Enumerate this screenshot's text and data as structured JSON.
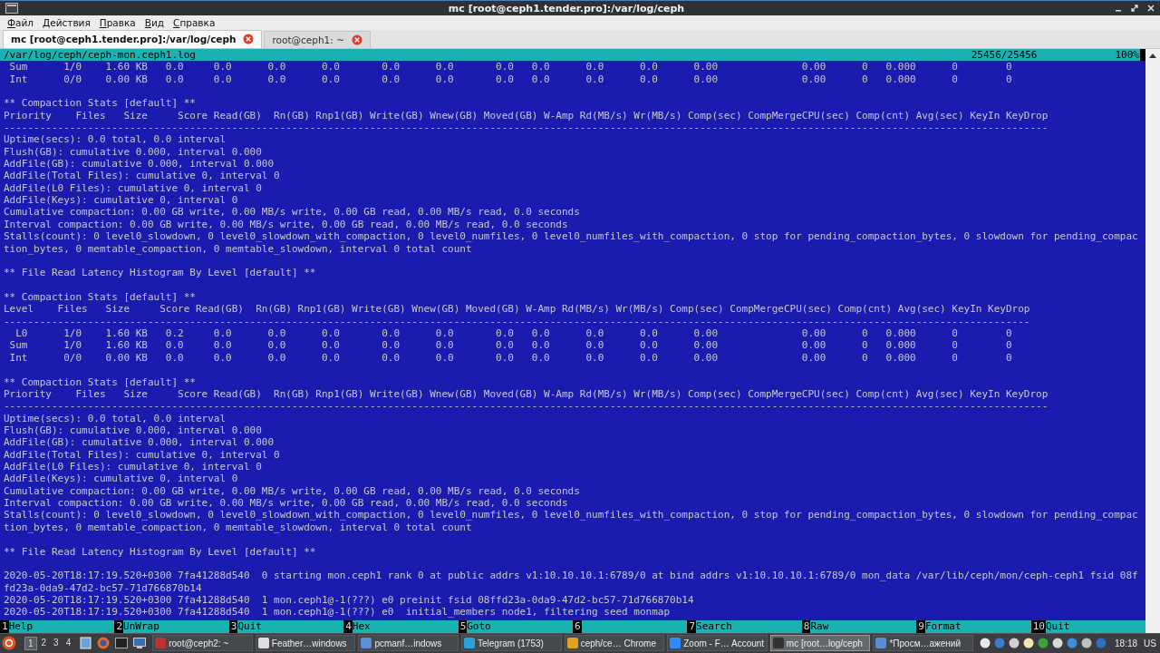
{
  "window": {
    "title": "mc [root@ceph1.tender.pro]:/var/log/ceph"
  },
  "menu": [
    "Файл",
    "Действия",
    "Правка",
    "Вид",
    "Справка"
  ],
  "tabs": [
    {
      "label": "mc [root@ceph1.tender.pro]:/var/log/ceph",
      "selected": true
    },
    {
      "label": "root@ceph1: ~",
      "selected": false
    }
  ],
  "terminal": {
    "status": {
      "file": "/var/log/ceph/ceph-mon.ceph1.log",
      "position": "25456/25456",
      "percent": "100%"
    },
    "blocks": [
      {
        "lines": [
          " Sum      1/0    1.60 KB   0.0     0.0      0.0      0.0       0.0      0.0       0.0   0.0      0.0      0.0      0.00              0.00      0   0.000      0        0",
          " Int      0/0    0.00 KB   0.0     0.0      0.0      0.0       0.0      0.0       0.0   0.0      0.0      0.0      0.00              0.00      0   0.000      0        0"
        ]
      },
      {
        "lines": [
          "** Compaction Stats [default] **",
          "Priority    Files   Size     Score Read(GB)  Rn(GB) Rnp1(GB) Write(GB) Wnew(GB) Moved(GB) W-Amp Rd(MB/s) Wr(MB/s) Comp(sec) CompMergeCPU(sec) Comp(cnt) Avg(sec) KeyIn KeyDrop",
          "------------------------------------------------------------------------------------------------------------------------------------------------------------------------------",
          "Uptime(secs): 0.0 total, 0.0 interval",
          "Flush(GB): cumulative 0.000, interval 0.000",
          "AddFile(GB): cumulative 0.000, interval 0.000",
          "AddFile(Total Files): cumulative 0, interval 0",
          "AddFile(L0 Files): cumulative 0, interval 0",
          "AddFile(Keys): cumulative 0, interval 0",
          "Cumulative compaction: 0.00 GB write, 0.00 MB/s write, 0.00 GB read, 0.00 MB/s read, 0.0 seconds",
          "Interval compaction: 0.00 GB write, 0.00 MB/s write, 0.00 GB read, 0.00 MB/s read, 0.0 seconds",
          "Stalls(count): 0 level0_slowdown, 0 level0_slowdown_with_compaction, 0 level0_numfiles, 0 level0_numfiles_with_compaction, 0 stop for pending_compaction_bytes, 0 slowdown for pending_compac",
          "tion_bytes, 0 memtable_compaction, 0 memtable_slowdown, interval 0 total count"
        ]
      },
      {
        "lines": [
          "** File Read Latency Histogram By Level [default] **"
        ]
      },
      {
        "lines": [
          "** Compaction Stats [default] **",
          "Level    Files   Size     Score Read(GB)  Rn(GB) Rnp1(GB) Write(GB) Wnew(GB) Moved(GB) W-Amp Rd(MB/s) Wr(MB/s) Comp(sec) CompMergeCPU(sec) Comp(cnt) Avg(sec) KeyIn KeyDrop",
          "---------------------------------------------------------------------------------------------------------------------------------------------------------------------------",
          "  L0      1/0    1.60 KB   0.2     0.0      0.0      0.0       0.0      0.0       0.0   0.0      0.0      0.0      0.00              0.00      0   0.000      0        0",
          " Sum      1/0    1.60 KB   0.0     0.0      0.0      0.0       0.0      0.0       0.0   0.0      0.0      0.0      0.00              0.00      0   0.000      0        0",
          " Int      0/0    0.00 KB   0.0     0.0      0.0      0.0       0.0      0.0       0.0   0.0      0.0      0.0      0.00              0.00      0   0.000      0        0"
        ]
      },
      {
        "lines": [
          "** Compaction Stats [default] **",
          "Priority    Files   Size     Score Read(GB)  Rn(GB) Rnp1(GB) Write(GB) Wnew(GB) Moved(GB) W-Amp Rd(MB/s) Wr(MB/s) Comp(sec) CompMergeCPU(sec) Comp(cnt) Avg(sec) KeyIn KeyDrop",
          "------------------------------------------------------------------------------------------------------------------------------------------------------------------------------",
          "Uptime(secs): 0.0 total, 0.0 interval",
          "Flush(GB): cumulative 0.000, interval 0.000",
          "AddFile(GB): cumulative 0.000, interval 0.000",
          "AddFile(Total Files): cumulative 0, interval 0",
          "AddFile(L0 Files): cumulative 0, interval 0",
          "AddFile(Keys): cumulative 0, interval 0",
          "Cumulative compaction: 0.00 GB write, 0.00 MB/s write, 0.00 GB read, 0.00 MB/s read, 0.0 seconds",
          "Interval compaction: 0.00 GB write, 0.00 MB/s write, 0.00 GB read, 0.00 MB/s read, 0.0 seconds",
          "Stalls(count): 0 level0_slowdown, 0 level0_slowdown_with_compaction, 0 level0_numfiles, 0 level0_numfiles_with_compaction, 0 stop for pending_compaction_bytes, 0 slowdown for pending_compac",
          "tion_bytes, 0 memtable_compaction, 0 memtable_slowdown, interval 0 total count"
        ]
      },
      {
        "lines": [
          "** File Read Latency Histogram By Level [default] **"
        ]
      },
      {
        "lines": [
          "2020-05-20T18:17:19.520+0300 7fa41288d540  0 starting mon.ceph1 rank 0 at public addrs v1:10.10.10.1:6789/0 at bind addrs v1:10.10.10.1:6789/0 mon_data /var/lib/ceph/mon/ceph-ceph1 fsid 08f",
          "fd23a-0da9-47d2-bc57-71d766870b14",
          "2020-05-20T18:17:19.520+0300 7fa41288d540  1 mon.ceph1@-1(???) e0 preinit fsid 08ffd23a-0da9-47d2-bc57-71d766870b14",
          "2020-05-20T18:17:19.520+0300 7fa41288d540  1 mon.ceph1@-1(???) e0  initial_members node1, filtering seed monmap"
        ]
      }
    ],
    "function_keys": [
      {
        "key": "1",
        "label": "Help"
      },
      {
        "key": "2",
        "label": "UnWrap"
      },
      {
        "key": "3",
        "label": "Quit"
      },
      {
        "key": "4",
        "label": "Hex"
      },
      {
        "key": "5",
        "label": "Goto"
      },
      {
        "key": "6"
      },
      {
        "key": "7",
        "label": "Search"
      },
      {
        "key": "8",
        "label": "Raw"
      },
      {
        "key": "9",
        "label": "Format"
      },
      {
        "key": "10",
        "label": "Quit"
      }
    ]
  },
  "taskbar": {
    "workspaces": [
      {
        "label": "1",
        "selected": true
      },
      {
        "label": "2",
        "selected": false
      },
      {
        "label": "3",
        "selected": false
      },
      {
        "label": "4",
        "selected": false
      }
    ],
    "tasks": [
      {
        "label": "root@ceph2: ~",
        "selected": false
      },
      {
        "label": "Feather…windows",
        "selected": false
      },
      {
        "label": "pcmanf…indows",
        "selected": false
      },
      {
        "label": "Telegram (1753)",
        "selected": false
      },
      {
        "label": "ceph/ce… Chrome",
        "selected": false
      },
      {
        "label": "Zoom - F… Account",
        "selected": false
      },
      {
        "label": "mc [root…log/ceph",
        "selected": true
      },
      {
        "label": "*Просм…ажений",
        "selected": false
      }
    ],
    "clock": "18:18",
    "layout": "US"
  }
}
